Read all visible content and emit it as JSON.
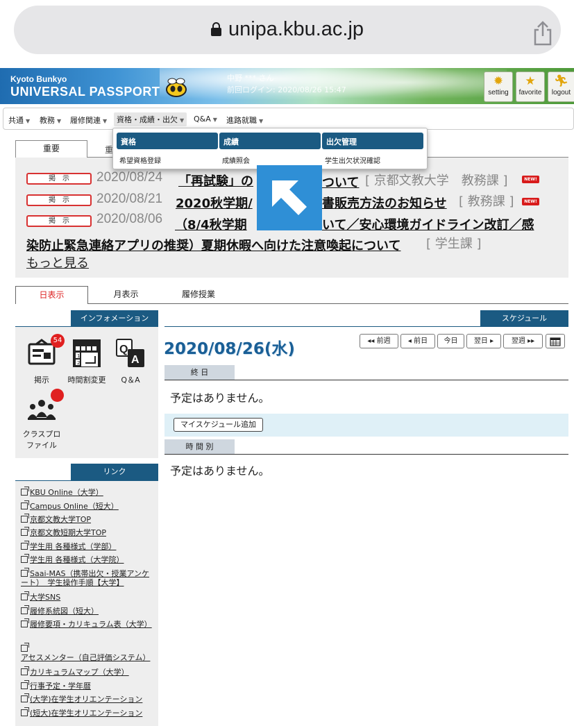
{
  "browser": {
    "url": "unipa.kbu.ac.jp"
  },
  "header": {
    "brand_small": "Kyoto Bunkyo",
    "brand_big": "UNIVERSAL PASSPORT",
    "user_line1": "中野 *** さん",
    "user_line2": "前回ログイン: 2020/08/26 15:47",
    "buttons": {
      "setting": "setting",
      "favorite": "favorite",
      "logout": "logout"
    }
  },
  "menu": {
    "items": [
      "共通",
      "教務",
      "履修関連",
      "資格・成績・出欠",
      "Q&A",
      "進路就職"
    ]
  },
  "dropdown": {
    "columns": [
      {
        "title": "資格",
        "link": "希望資格登録"
      },
      {
        "title": "成績",
        "link": "成績照会"
      },
      {
        "title": "出欠管理",
        "link": "学生出欠状況確認"
      }
    ]
  },
  "notice": {
    "tabs": [
      "重要",
      "重"
    ],
    "items": [
      {
        "badge": "掲　示",
        "date": "2020/08/24",
        "title": "「再試験」の",
        "title_end": "ついて",
        "dept": "[ 京都文教大学　教務課 ]",
        "new": "NEW!"
      },
      {
        "badge": "掲　示",
        "date": "2020/08/21",
        "title": "2020秋学期/",
        "title_end": "書販売方法のお知らせ",
        "dept": "[ 教務課 ]",
        "new": "NEW!"
      },
      {
        "badge": "掲　示",
        "date": "2020/08/06",
        "title": "（8/4秋学期",
        "title_end": "いて／安心環境ガイドライン改訂／感",
        "title_line2": "染防止緊急連絡アプリの推奨）夏期休暇へ向けた注意喚起について",
        "dept": "[ 学生課 ]"
      }
    ],
    "more": "もっと見る"
  },
  "schedule_tabs": [
    "日表示",
    "月表示",
    "履修授業"
  ],
  "info": {
    "header": "インフォメーション",
    "items": [
      {
        "label": "掲示",
        "badge": "54"
      },
      {
        "label": "時間割変更"
      },
      {
        "label": "Q＆A"
      },
      {
        "label_line1": "クラスプロ",
        "label_line2": "ファイル"
      }
    ]
  },
  "links": {
    "header": "リンク",
    "items": [
      "KBU Online（大学）",
      "Campus Online（短大）",
      "京都文教大学TOP",
      "京都文教短期大学TOP",
      "学生用 各種様式（学部）",
      "学生用 各種様式（大学院）",
      "Saai-MAS（携帯出欠・授業アンケート）　学生操作手順【大学】",
      "大学SNS",
      "履修系統図（短大）",
      "履修要項・カリキュラム表（大学）",
      "アセスメンター（自己評価システム）",
      "カリキュラムマップ（大学）",
      "行事予定・学年暦",
      "(大学)在学生オリエンテーション",
      "(短大)在学生オリエンテーション"
    ]
  },
  "schedule": {
    "header": "スケジュール",
    "date": "2020/08/26(水)",
    "nav": [
      "◂◂ 前週",
      "◂ 前日",
      "今日",
      "翌日 ▸",
      "翌週 ▸▸"
    ],
    "all_day_label": "終 日",
    "all_day_empty": "予定はありません。",
    "add_button": "マイスケジュール追加",
    "timed_label": "時 間 別",
    "timed_empty": "予定はありません。"
  },
  "icons": [
    "lock-icon",
    "share-icon",
    "gear-icon",
    "star-icon",
    "runner-icon",
    "bulletin-icon",
    "timetable-icon",
    "qa-icon",
    "class-profile-icon",
    "calendar-icon",
    "external-link-icon",
    "arrow-up-left-icon"
  ]
}
